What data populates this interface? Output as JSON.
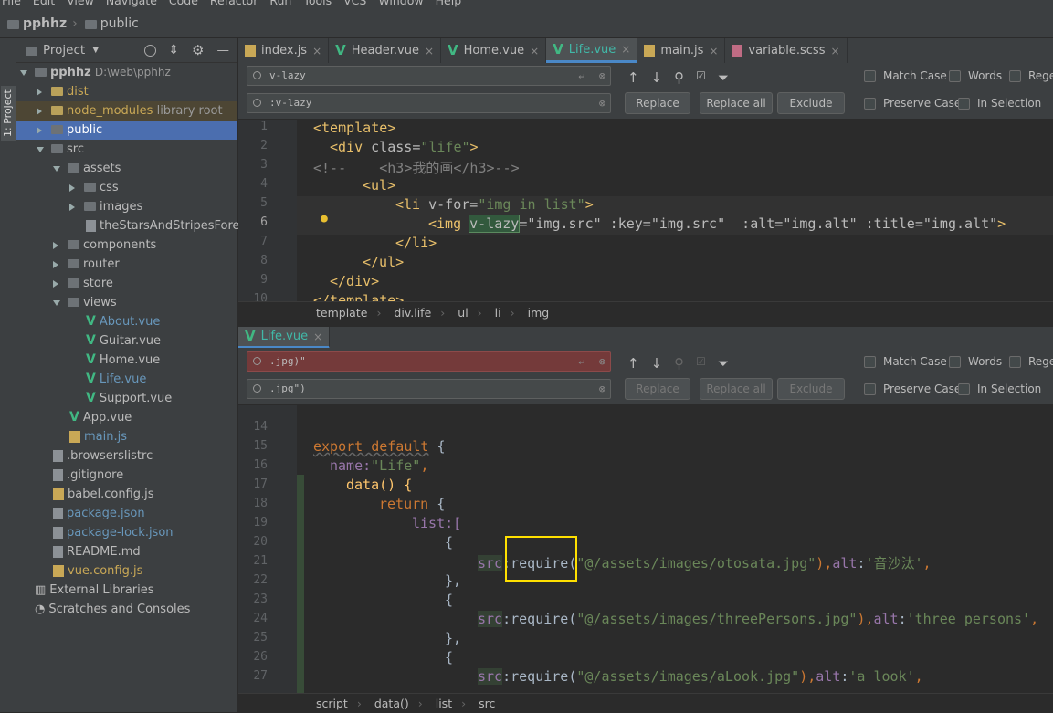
{
  "menu": [
    "File",
    "Edit",
    "View",
    "Navigate",
    "Code",
    "Refactor",
    "Run",
    "Tools",
    "VCS",
    "Window",
    "Help"
  ],
  "breadcrumb": {
    "project": "pphhz",
    "folder": "public"
  },
  "side_tool_window": "1: Project",
  "project_panel": {
    "title": "Project"
  },
  "tree": [
    {
      "label": "pphhz",
      "extra": "D:\\web\\pphhz"
    },
    {
      "label": "dist"
    },
    {
      "label": "node_modules",
      "extra": "library root"
    },
    {
      "label": "public"
    },
    {
      "label": "src"
    },
    {
      "label": "assets"
    },
    {
      "label": "css"
    },
    {
      "label": "images"
    },
    {
      "label": "theStarsAndStripesForeve"
    },
    {
      "label": "components"
    },
    {
      "label": "router"
    },
    {
      "label": "store"
    },
    {
      "label": "views"
    },
    {
      "label": "About.vue"
    },
    {
      "label": "Guitar.vue"
    },
    {
      "label": "Home.vue"
    },
    {
      "label": "Life.vue"
    },
    {
      "label": "Support.vue"
    },
    {
      "label": "App.vue"
    },
    {
      "label": "main.js"
    },
    {
      "label": ".browserslistrc"
    },
    {
      "label": ".gitignore"
    },
    {
      "label": "babel.config.js"
    },
    {
      "label": "package.json"
    },
    {
      "label": "package-lock.json"
    },
    {
      "label": "README.md"
    },
    {
      "label": "vue.config.js"
    },
    {
      "label": "External Libraries"
    },
    {
      "label": "Scratches and Consoles"
    }
  ],
  "tabs": [
    "index.js",
    "Header.vue",
    "Home.vue",
    "Life.vue",
    "main.js",
    "variable.scss"
  ],
  "find1": {
    "search": "v-lazy",
    "replace": ":v-lazy"
  },
  "find2": {
    "search": ".jpg)\"",
    "replace": ".jpg\")"
  },
  "find_buttons": {
    "replace": "Replace",
    "replace_all": "Replace all",
    "exclude": "Exclude"
  },
  "find_options": {
    "match_case": "Match Case",
    "words": "Words",
    "regex": "Regex",
    "preserve_case": "Preserve Case",
    "in_selection": "In Selection"
  },
  "editor2_tab": "Life.vue",
  "crumb1": [
    "template",
    "div.life",
    "ul",
    "li",
    "img"
  ],
  "crumb2": [
    "script",
    "data()",
    "list",
    "src"
  ],
  "code1_lines": [
    "1",
    "2",
    "3",
    "4",
    "5",
    "6",
    "7",
    "8",
    "9",
    "10"
  ],
  "code2_lines": [
    "14",
    "15",
    "16",
    "17",
    "18",
    "19",
    "20",
    "21",
    "22",
    "23",
    "24",
    "25",
    "26",
    "27"
  ],
  "code1": {
    "l1": "<template>",
    "l2a": "<div ",
    "l2b": "class",
    "l2c": "=",
    "l2d": "\"life\"",
    "l2e": ">",
    "l3": "<!--    <h3>我的画</h3>-->",
    "l4": "<ul>",
    "l5a": "<li ",
    "l5b": "v-for=",
    "l5c": "\"img in list\"",
    "l5d": ">",
    "l6a": "<img ",
    "l6b": "v-lazy",
    "l6c": "=\"img.src\"",
    "l6d": " :key=\"img.src\"",
    "l6e": "  :alt=\"img.alt\"",
    "l6f": " :title=\"img.alt\"",
    "l6g": ">",
    "l7": "</li>",
    "l8": "</ul>",
    "l9": "</div>",
    "l10": "</template>"
  },
  "code2": {
    "l15a": "export default",
    "l15b": " {",
    "l16a": "name:",
    "l16b": "\"Life\"",
    "l16c": ",",
    "l17": "data() {",
    "l18a": "return",
    " l18b": " {",
    "l19": "list:[",
    "l20": "{",
    "l21a": "src",
    ":l21b": ":require(",
    "l21c": "\"@/assets/images/otosata.jpg\"",
    "l21d": "),",
    "l21e": "alt",
    "l21f": ":",
    "l21g": "'音沙汰'",
    "l21h": ",",
    "l22": "},",
    "l23": "{",
    "l24a": "src",
    "l24b": ":require(",
    "l24c": "\"@/assets/images/threePersons.jpg\"",
    "l24d": "),",
    "l24e": "alt",
    "l24f": ":",
    "l24g": "'three persons'",
    "l24h": ",",
    "l25": "},",
    "l26": "{",
    "l27a": "src",
    "l27b": ":require(",
    "l27c": "\"@/assets/images/aLook.jpg\"",
    "l27d": "),",
    "l27e": "alt",
    "l27f": ":",
    "l27g": "'a look'",
    "l27h": ","
  }
}
